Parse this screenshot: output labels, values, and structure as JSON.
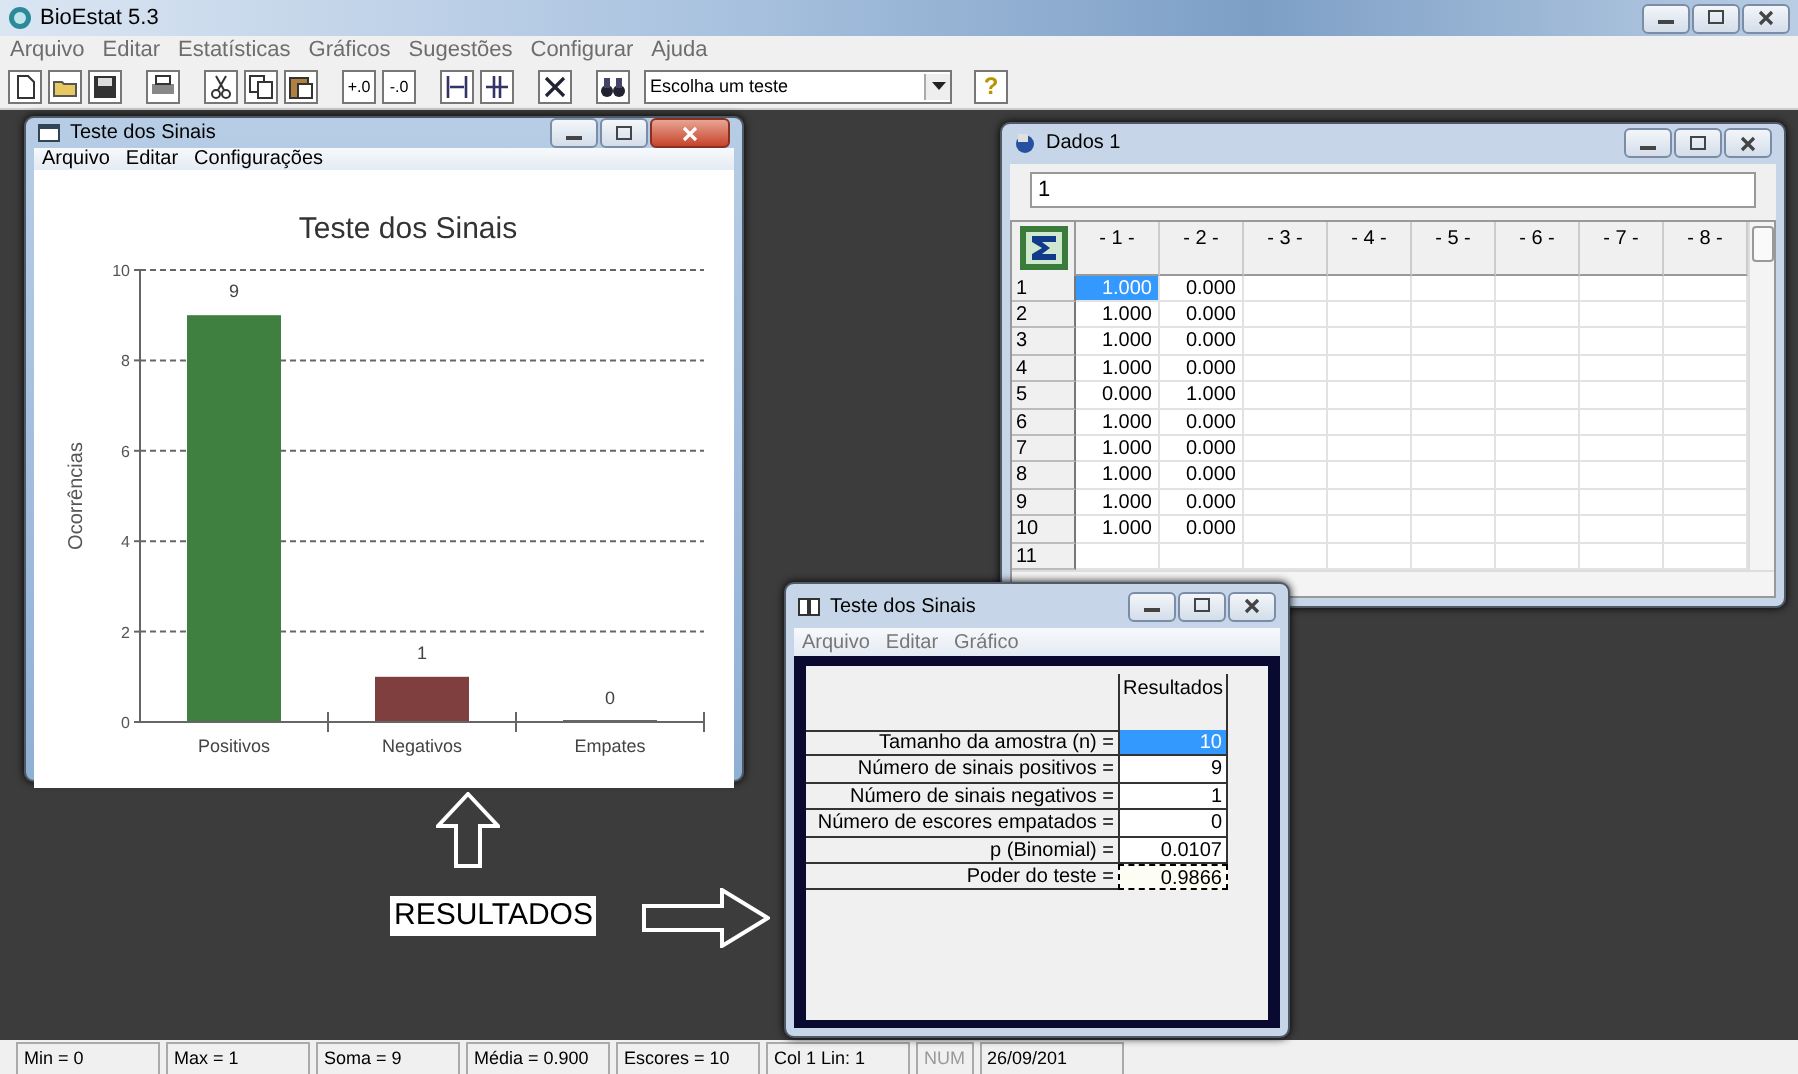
{
  "window": {
    "title": "BioEstat 5.3"
  },
  "menu": [
    "Arquivo",
    "Editar",
    "Estatísticas",
    "Gráficos",
    "Sugestões",
    "Configurar",
    "Ajuda"
  ],
  "toolbar": {
    "decimal_buttons": [
      "+.0",
      "-.0"
    ],
    "test_select": {
      "value": "Escolha um teste"
    },
    "help_button": "?"
  },
  "chart_window": {
    "title": "Teste dos Sinais",
    "menu": [
      "Arquivo",
      "Editar",
      "Configurações"
    ],
    "chart_data": {
      "type": "bar",
      "title": "Teste dos Sinais",
      "ylabel": "Ocorrências",
      "categories": [
        "Positivos",
        "Negativos",
        "Empates"
      ],
      "values": [
        9,
        1,
        0
      ],
      "colors": [
        "#3f7f3f",
        "#7f3f3f",
        "#666666"
      ],
      "ylim": [
        0,
        10
      ],
      "yticks": [
        0,
        2,
        4,
        6,
        8,
        10
      ],
      "grid": true,
      "data_labels": true
    }
  },
  "data_window": {
    "title": "Dados 1",
    "formula_value": "1",
    "columns": [
      "- 1 -",
      "- 2 -",
      "- 3 -",
      "- 4 -",
      "- 5 -",
      "- 6 -",
      "- 7 -",
      "- 8 -"
    ],
    "rows": [
      {
        "header": "1",
        "cells": [
          {
            "text": "1.000",
            "selected": true
          },
          {
            "text": "0.000",
            "selected": false
          }
        ]
      },
      {
        "header": "2",
        "cells": [
          {
            "text": "1.000",
            "selected": false
          },
          {
            "text": "0.000",
            "selected": false
          }
        ]
      },
      {
        "header": "3",
        "cells": [
          {
            "text": "1.000",
            "selected": false
          },
          {
            "text": "0.000",
            "selected": false
          }
        ]
      },
      {
        "header": "4",
        "cells": [
          {
            "text": "1.000",
            "selected": false
          },
          {
            "text": "0.000",
            "selected": false
          }
        ]
      },
      {
        "header": "5",
        "cells": [
          {
            "text": "0.000",
            "selected": false
          },
          {
            "text": "1.000",
            "selected": false
          }
        ]
      },
      {
        "header": "6",
        "cells": [
          {
            "text": "1.000",
            "selected": false
          },
          {
            "text": "0.000",
            "selected": false
          }
        ]
      },
      {
        "header": "7",
        "cells": [
          {
            "text": "1.000",
            "selected": false
          },
          {
            "text": "0.000",
            "selected": false
          }
        ]
      },
      {
        "header": "8",
        "cells": [
          {
            "text": "1.000",
            "selected": false
          },
          {
            "text": "0.000",
            "selected": false
          }
        ]
      },
      {
        "header": "9",
        "cells": [
          {
            "text": "1.000",
            "selected": false
          },
          {
            "text": "0.000",
            "selected": false
          }
        ]
      },
      {
        "header": "10",
        "cells": [
          {
            "text": "1.000",
            "selected": false
          },
          {
            "text": "0.000",
            "selected": false
          }
        ]
      },
      {
        "header": "11",
        "cells": []
      }
    ]
  },
  "results_window": {
    "title": "Teste dos Sinais",
    "menu": [
      "Arquivo",
      "Editar",
      "Gráfico"
    ],
    "column_header": "Resultados",
    "rows": [
      {
        "label": "Tamanho da amostra (n) =",
        "value": "10",
        "selected": true,
        "focused": false
      },
      {
        "label": "Número de sinais positivos =",
        "value": "9",
        "selected": false,
        "focused": false
      },
      {
        "label": "Número de sinais negativos =",
        "value": "1",
        "selected": false,
        "focused": false
      },
      {
        "label": "Número de escores empatados =",
        "value": "0",
        "selected": false,
        "focused": false
      },
      {
        "label": "p (Binomial) =",
        "value": "0.0107",
        "selected": false,
        "focused": false
      },
      {
        "label": "Poder do teste =",
        "value": "0.9866",
        "selected": false,
        "focused": true
      }
    ]
  },
  "annotation": {
    "label": "RESULTADOS"
  },
  "status_bar": [
    {
      "text": "Min = 0",
      "disabled": false
    },
    {
      "text": "Max = 1",
      "disabled": false
    },
    {
      "text": "Soma = 9",
      "disabled": false
    },
    {
      "text": "Média = 0.900",
      "disabled": false
    },
    {
      "text": "Escores = 10",
      "disabled": false
    },
    {
      "text": "Col 1  Lin: 1",
      "disabled": false
    },
    {
      "text": "NUM",
      "disabled": true
    },
    {
      "text": "26/09/201",
      "disabled": false
    }
  ]
}
